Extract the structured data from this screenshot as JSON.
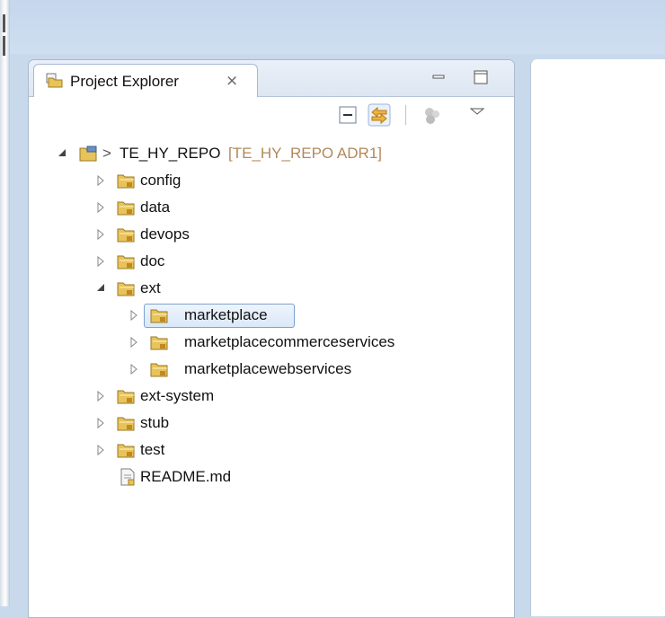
{
  "view": {
    "title": "Project Explorer",
    "close_glyph": "⨯",
    "icons": {
      "tab": "package-folder-icon",
      "minimize": "minimize-icon",
      "maximize": "maximize-icon",
      "collapse_all": "collapse-all-icon",
      "link_with_editor": "link-with-editor-icon",
      "filters": "filters-icon",
      "view_menu": "view-menu-chevron-icon"
    }
  },
  "tree": {
    "root": {
      "prefix": "> ",
      "name": "TE_HY_REPO",
      "decoration": "[TE_HY_REPO ADR1]",
      "expanded": true
    },
    "items": [
      {
        "label": "config",
        "expanded": false
      },
      {
        "label": "data",
        "expanded": false
      },
      {
        "label": "devops",
        "expanded": false
      },
      {
        "label": "doc",
        "expanded": false
      },
      {
        "label": "ext",
        "expanded": true
      },
      {
        "label": "marketplace",
        "expanded": false,
        "selected": true
      },
      {
        "label": "marketplacecommerceservices",
        "expanded": false
      },
      {
        "label": "marketplacewebservices",
        "expanded": false
      },
      {
        "label": "ext-system",
        "expanded": false
      },
      {
        "label": "stub",
        "expanded": false
      },
      {
        "label": "test",
        "expanded": false
      },
      {
        "label": "README.md",
        "file": true
      }
    ]
  },
  "colors": {
    "decoration": "#b08a5a",
    "folder": "#e8c35a",
    "selection_border": "#7da2ce"
  }
}
